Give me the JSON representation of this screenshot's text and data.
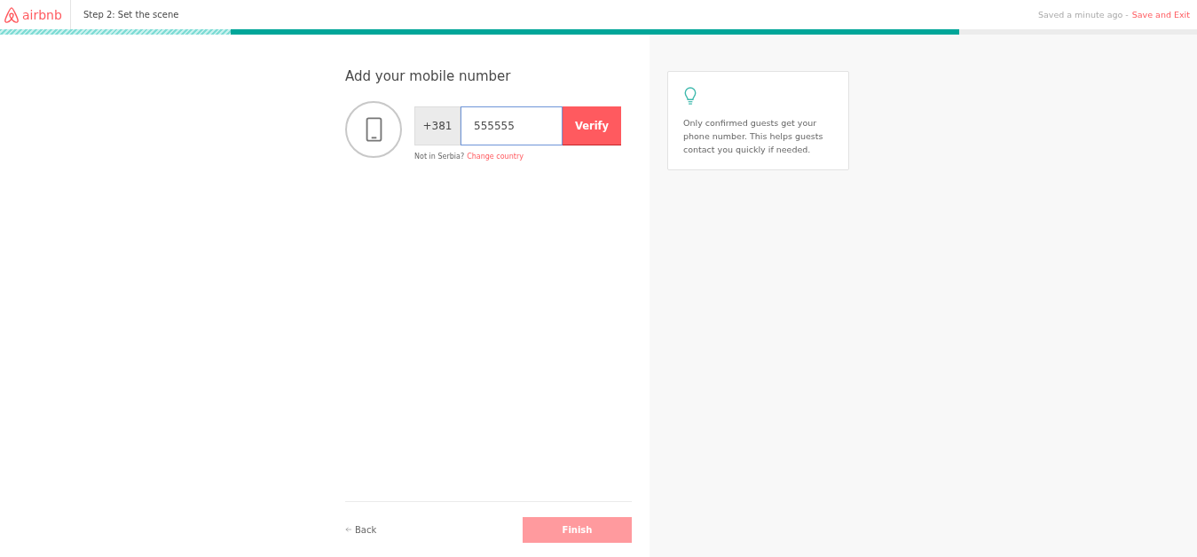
{
  "header": {
    "logo": "airbnb",
    "step": "Step 2: Set the scene",
    "saved": "Saved a minute ago -",
    "save_exit": "Save and Exit"
  },
  "progress": [
    {
      "kind": "done",
      "level": 0.193
    },
    {
      "kind": "current",
      "level": 0.801
    }
  ],
  "form": {
    "title": "Add your mobile number",
    "country_code": "+381",
    "phone": {
      "value": "555555",
      "focused": true
    },
    "verify": "Verify",
    "note": "Not in Serbia?",
    "change": "Change country"
  },
  "footer": {
    "back": "Back",
    "finish": {
      "label": "Finish",
      "disabled": true
    }
  },
  "tip": {
    "text": "Only confirmed guests get your phone number. This helps guests contact you quickly if needed."
  }
}
